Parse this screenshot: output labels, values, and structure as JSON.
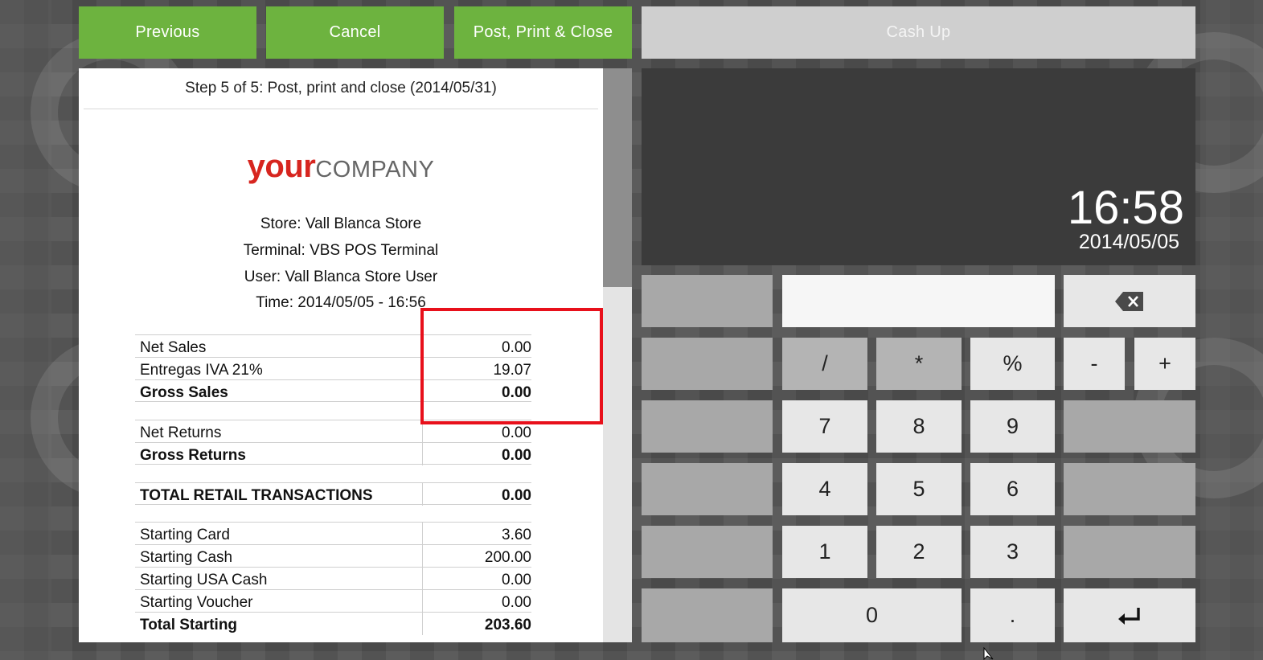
{
  "toolbar": {
    "previous_label": "Previous",
    "cancel_label": "Cancel",
    "post_label": "Post, Print & Close",
    "cashup_label": "Cash Up"
  },
  "receipt": {
    "step_title": "Step 5 of 5: Post, print and close (2014/05/31)",
    "logo_your": "your",
    "logo_company": "COMPANY",
    "store": "Store: Vall Blanca Store",
    "terminal": "Terminal: VBS POS Terminal",
    "user": "User: Vall Blanca Store User",
    "time": "Time: 2014/05/05 - 16:56",
    "rows": [
      {
        "label": "Net Sales",
        "value": "0.00"
      },
      {
        "label": "Entregas IVA 21%",
        "value": "19.07"
      },
      {
        "label": "Gross Sales",
        "value": "0.00"
      },
      {
        "label": "Net Returns",
        "value": "0.00"
      },
      {
        "label": "Gross Returns",
        "value": "0.00"
      },
      {
        "label": "TOTAL RETAIL TRANSACTIONS",
        "value": "0.00"
      },
      {
        "label": "Starting Card",
        "value": "3.60"
      },
      {
        "label": "Starting Cash",
        "value": "200.00"
      },
      {
        "label": "Starting USA Cash",
        "value": "0.00"
      },
      {
        "label": "Starting Voucher",
        "value": "0.00"
      },
      {
        "label": "Total Starting",
        "value": "203.60"
      }
    ]
  },
  "display": {
    "time": "16:58",
    "date": "2014/05/05"
  },
  "keypad": {
    "divide": "/",
    "multiply": "*",
    "percent": "%",
    "minus": "-",
    "plus": "+",
    "k7": "7",
    "k8": "8",
    "k9": "9",
    "k4": "4",
    "k5": "5",
    "k6": "6",
    "k1": "1",
    "k2": "2",
    "k3": "3",
    "k0": "0",
    "dot": "."
  },
  "colors": {
    "accent_green": "#6db33f",
    "highlight_red": "#e8101b",
    "logo_red": "#d7251f"
  }
}
